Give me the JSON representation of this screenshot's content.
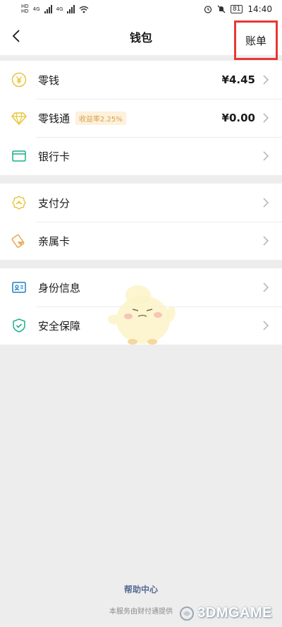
{
  "status_bar": {
    "left": {
      "hd1": "HD",
      "hd2": "HD",
      "net1": "4G",
      "net2": "4G"
    },
    "right": {
      "battery": "81",
      "time": "14:40"
    }
  },
  "header": {
    "back_icon": "back-icon",
    "title": "钱包",
    "bill_label": "账单",
    "highlight_color": "#e53935"
  },
  "sections": [
    {
      "items": [
        {
          "icon": "yuan-coin-icon",
          "label": "零钱",
          "value": "¥4.45"
        },
        {
          "icon": "diamond-icon",
          "label": "零钱通",
          "badge": "收益率2.25%",
          "value": "¥0.00"
        },
        {
          "icon": "bank-card-icon",
          "label": "银行卡"
        }
      ]
    },
    {
      "items": [
        {
          "icon": "payscore-icon",
          "label": "支付分"
        },
        {
          "icon": "family-card-icon",
          "label": "亲属卡"
        }
      ]
    },
    {
      "items": [
        {
          "icon": "id-card-icon",
          "label": "身份信息"
        },
        {
          "icon": "shield-icon",
          "label": "安全保障"
        }
      ]
    }
  ],
  "footer": {
    "help_center": "帮助中心",
    "provider_text": "本服务由财付通提供"
  },
  "watermark": {
    "text": "3DMGAME"
  },
  "colors": {
    "accent_yellow": "#e8c53a",
    "accent_teal": "#1aad8b",
    "link_blue": "#576b95"
  }
}
